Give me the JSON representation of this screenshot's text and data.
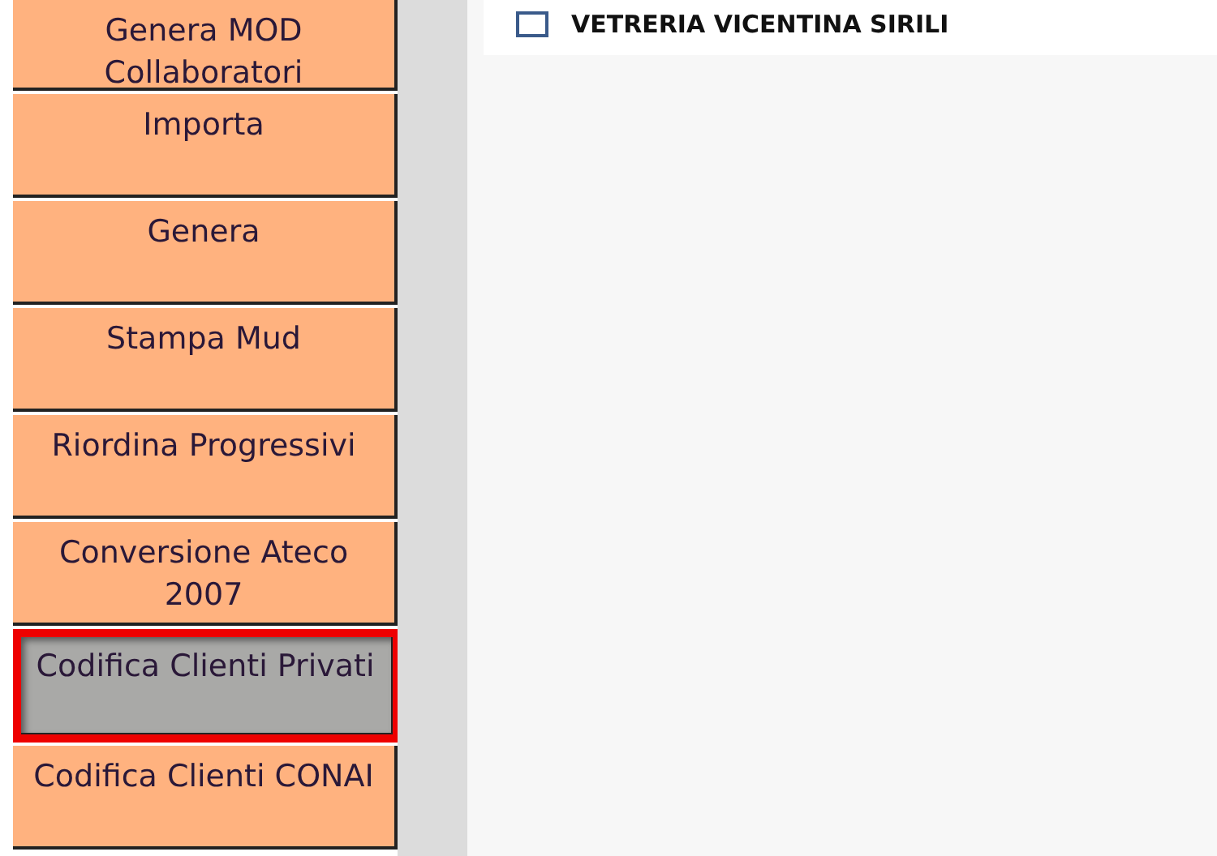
{
  "sidebar": {
    "items": [
      {
        "label": "Genera MOD Collaboratori",
        "selected": false
      },
      {
        "label": "Importa",
        "selected": false
      },
      {
        "label": "Genera",
        "selected": false
      },
      {
        "label": "Stampa Mud",
        "selected": false
      },
      {
        "label": "Riordina Progressivi",
        "selected": false
      },
      {
        "label": "Conversione Ateco 2007",
        "selected": false
      },
      {
        "label": "Codifica Clienti Privati",
        "selected": true
      },
      {
        "label": "Codifica Clienti CONAI",
        "selected": false
      }
    ]
  },
  "list": {
    "rows": [
      {
        "label": "VETRERIA VICENTINA SIRILI",
        "checked": false
      }
    ]
  }
}
